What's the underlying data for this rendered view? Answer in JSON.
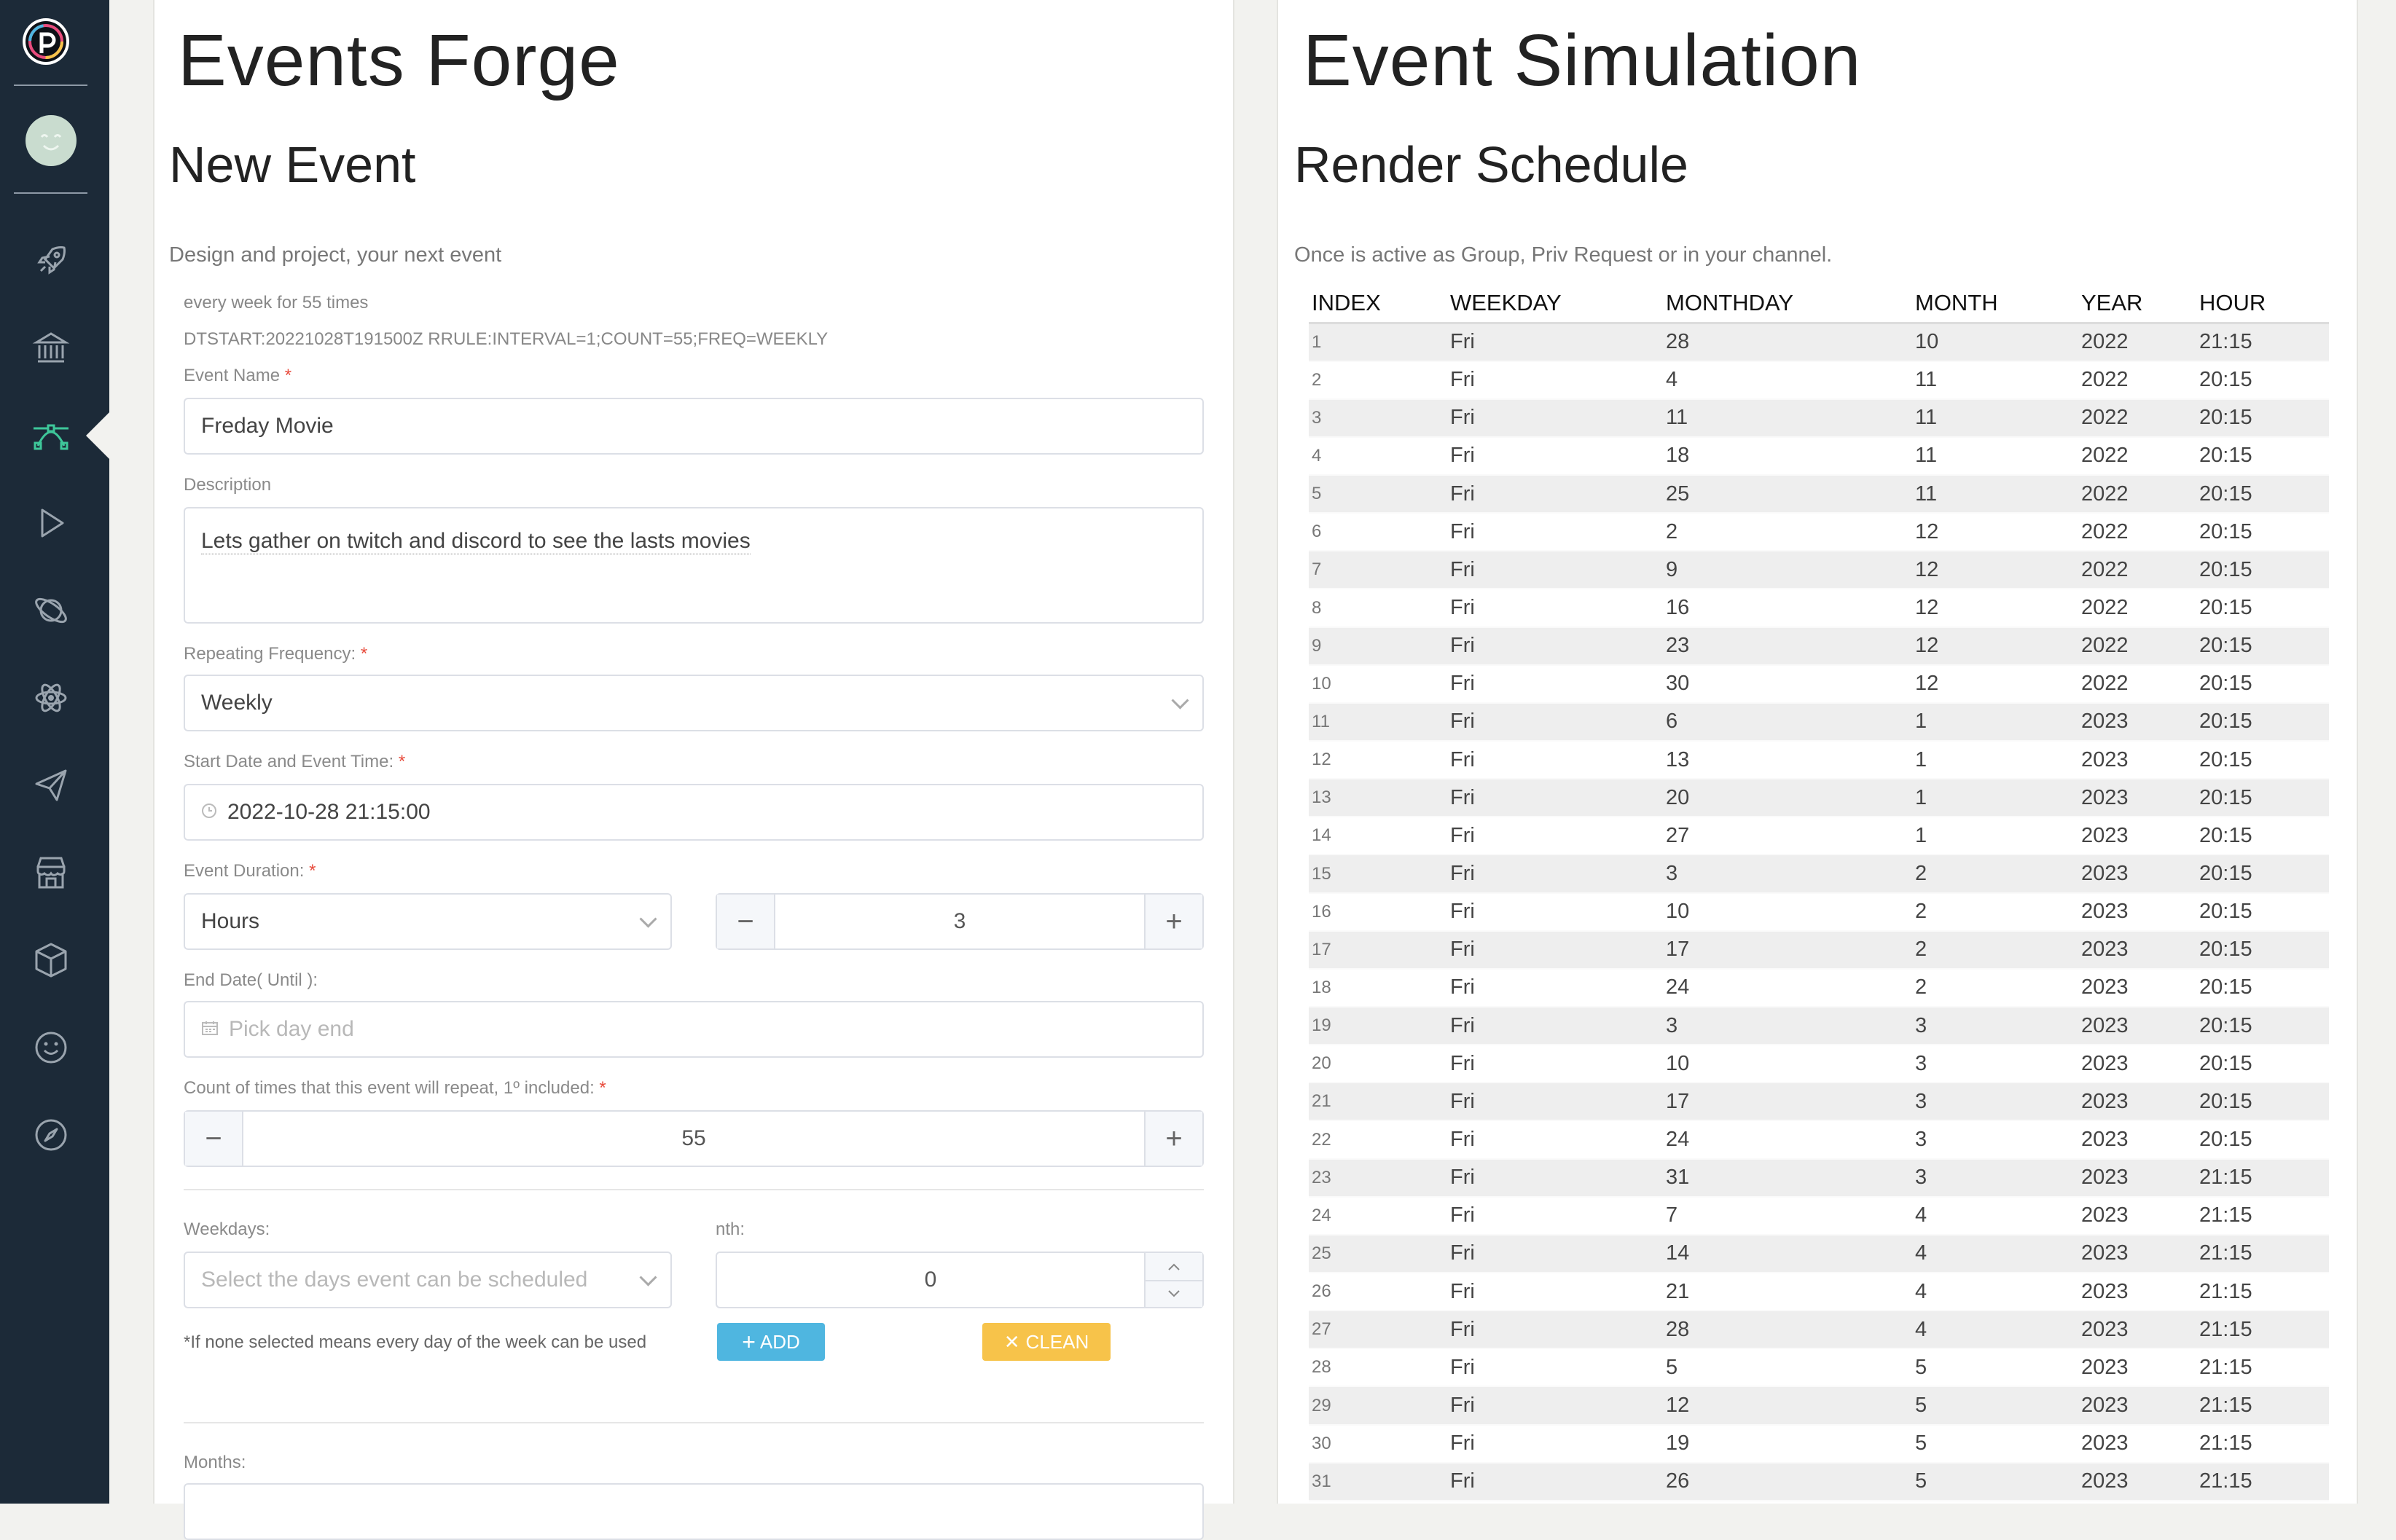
{
  "sidebar": {
    "items": [
      "rocket-icon",
      "bank-icon",
      "bezier-icon",
      "play-icon",
      "planet-icon",
      "atom-icon",
      "send-icon",
      "store-icon",
      "box-icon",
      "smile-icon",
      "compass-icon"
    ],
    "active": "bezier-icon",
    "accent_color": "#3ec79a"
  },
  "left": {
    "title": "Events Forge",
    "subtitle": "New Event",
    "tagline": "Design and project, your next event",
    "summary": "every week for 55 times",
    "rrule": "DTSTART:20221028T191500Z RRULE:INTERVAL=1;COUNT=55;FREQ=WEEKLY",
    "event_name_label": "Event Name",
    "event_name_value": "Freday Movie",
    "description_label": "Description",
    "description_value": "Lets gather on twitch and discord to see the lasts movies",
    "frequency_label": "Repeating Frequency:",
    "frequency_value": "Weekly",
    "start_label": "Start Date and Event Time:",
    "start_value": "2022-10-28 21:15:00",
    "duration_label": "Event Duration:",
    "duration_unit": "Hours",
    "duration_value": "3",
    "end_label": "End Date( Until ):",
    "end_placeholder": "Pick day end",
    "count_label": "Count of times that this event will repeat, 1º included:",
    "count_value": "55",
    "weekdays_label": "Weekdays:",
    "weekdays_placeholder": "Select the days event can be scheduled",
    "weekdays_note": "*If none selected means every day of the week can be used",
    "nth_label": "nth:",
    "nth_value": "0",
    "add_label": "ADD",
    "clean_label": "CLEAN",
    "months_label": "Months:",
    "required_mark": "*",
    "minus_glyph": "−",
    "plus_glyph": "+"
  },
  "right": {
    "title": "Event Simulation",
    "subtitle": "Render Schedule",
    "tagline": "Once is active as Group, Priv Request or in your channel.",
    "columns": [
      "INDEX",
      "WEEKDAY",
      "MONTHDAY",
      "MONTH",
      "YEAR",
      "HOUR"
    ],
    "rows": [
      [
        "1",
        "Fri",
        "28",
        "10",
        "2022",
        "21:15"
      ],
      [
        "2",
        "Fri",
        "4",
        "11",
        "2022",
        "20:15"
      ],
      [
        "3",
        "Fri",
        "11",
        "11",
        "2022",
        "20:15"
      ],
      [
        "4",
        "Fri",
        "18",
        "11",
        "2022",
        "20:15"
      ],
      [
        "5",
        "Fri",
        "25",
        "11",
        "2022",
        "20:15"
      ],
      [
        "6",
        "Fri",
        "2",
        "12",
        "2022",
        "20:15"
      ],
      [
        "7",
        "Fri",
        "9",
        "12",
        "2022",
        "20:15"
      ],
      [
        "8",
        "Fri",
        "16",
        "12",
        "2022",
        "20:15"
      ],
      [
        "9",
        "Fri",
        "23",
        "12",
        "2022",
        "20:15"
      ],
      [
        "10",
        "Fri",
        "30",
        "12",
        "2022",
        "20:15"
      ],
      [
        "11",
        "Fri",
        "6",
        "1",
        "2023",
        "20:15"
      ],
      [
        "12",
        "Fri",
        "13",
        "1",
        "2023",
        "20:15"
      ],
      [
        "13",
        "Fri",
        "20",
        "1",
        "2023",
        "20:15"
      ],
      [
        "14",
        "Fri",
        "27",
        "1",
        "2023",
        "20:15"
      ],
      [
        "15",
        "Fri",
        "3",
        "2",
        "2023",
        "20:15"
      ],
      [
        "16",
        "Fri",
        "10",
        "2",
        "2023",
        "20:15"
      ],
      [
        "17",
        "Fri",
        "17",
        "2",
        "2023",
        "20:15"
      ],
      [
        "18",
        "Fri",
        "24",
        "2",
        "2023",
        "20:15"
      ],
      [
        "19",
        "Fri",
        "3",
        "3",
        "2023",
        "20:15"
      ],
      [
        "20",
        "Fri",
        "10",
        "3",
        "2023",
        "20:15"
      ],
      [
        "21",
        "Fri",
        "17",
        "3",
        "2023",
        "20:15"
      ],
      [
        "22",
        "Fri",
        "24",
        "3",
        "2023",
        "20:15"
      ],
      [
        "23",
        "Fri",
        "31",
        "3",
        "2023",
        "21:15"
      ],
      [
        "24",
        "Fri",
        "7",
        "4",
        "2023",
        "21:15"
      ],
      [
        "25",
        "Fri",
        "14",
        "4",
        "2023",
        "21:15"
      ],
      [
        "26",
        "Fri",
        "21",
        "4",
        "2023",
        "21:15"
      ],
      [
        "27",
        "Fri",
        "28",
        "4",
        "2023",
        "21:15"
      ],
      [
        "28",
        "Fri",
        "5",
        "5",
        "2023",
        "21:15"
      ],
      [
        "29",
        "Fri",
        "12",
        "5",
        "2023",
        "21:15"
      ],
      [
        "30",
        "Fri",
        "19",
        "5",
        "2023",
        "21:15"
      ],
      [
        "31",
        "Fri",
        "26",
        "5",
        "2023",
        "21:15"
      ]
    ]
  }
}
